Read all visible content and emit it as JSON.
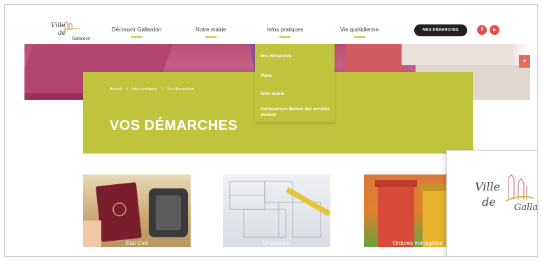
{
  "header": {
    "logo": {
      "line1": "Ville",
      "line2": "de",
      "line3": "Gallardon"
    },
    "nav": [
      {
        "label": "Découvrir Gallardon"
      },
      {
        "label": "Notre mairie"
      },
      {
        "label": "Infos pratiques"
      },
      {
        "label": "Vie quotidienne"
      }
    ],
    "cta_label": "MES DÉMARCHES",
    "social": [
      {
        "icon": "facebook-icon",
        "glyph": "f"
      },
      {
        "icon": "youtube-icon",
        "glyph": "▶"
      }
    ]
  },
  "dropdown": {
    "items": [
      {
        "label": "Vos démarches"
      },
      {
        "label": "Plans"
      },
      {
        "label": "Infos mairie"
      },
      {
        "label": "Permanences Maison des services sociaux"
      }
    ]
  },
  "banner": {
    "breadcrumb": [
      "Accueil",
      ">",
      "Infos pratiques",
      ">",
      "Vos démarches"
    ],
    "title": "VOS DÉMARCHES"
  },
  "cards": [
    {
      "label": "État Civil"
    },
    {
      "label": "Urbanisme"
    },
    {
      "label": "Ordures ménagères"
    }
  ],
  "overlay_logo": {
    "line1": "Ville",
    "line2": "de",
    "line3": "Gallardon"
  },
  "colors": {
    "accent": "#c0c43c",
    "cta": "#222222",
    "social": "#e0524a"
  }
}
